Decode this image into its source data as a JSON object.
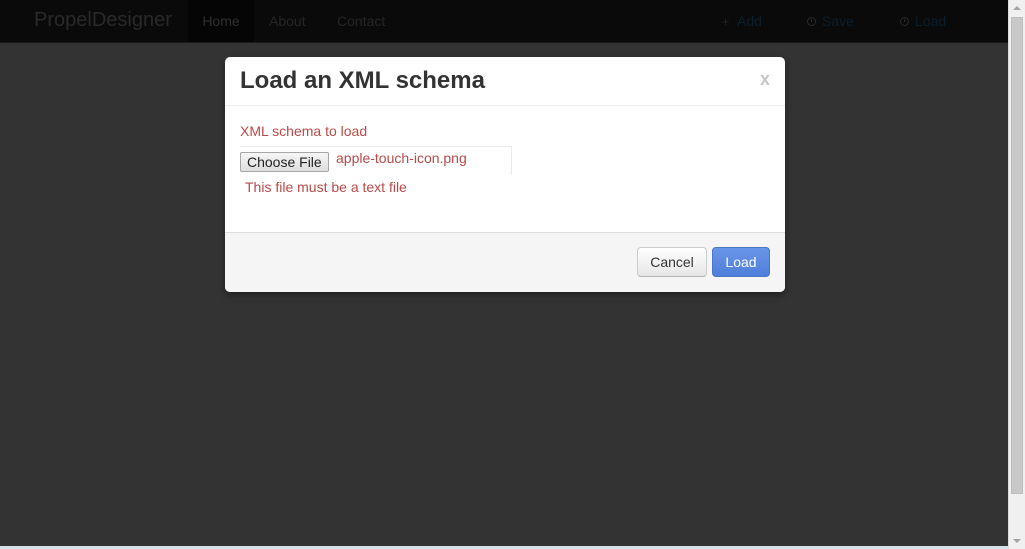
{
  "navbar": {
    "brand": "PropelDesigner",
    "links": [
      "Home",
      "About",
      "Contact"
    ],
    "actions": {
      "add": "Add",
      "save": "Save",
      "load": "Load"
    }
  },
  "modal": {
    "title": "Load an XML schema",
    "close": "x",
    "field_label": "XML schema to load",
    "file_button": "Choose File",
    "file_name": "apple-touch-icon.png",
    "help_text": "This file must be a text file",
    "cancel_label": "Cancel",
    "load_label": "Load"
  },
  "colors": {
    "error": "#b94a48",
    "primary_button": "#5b89df",
    "backdrop": "#333333"
  }
}
